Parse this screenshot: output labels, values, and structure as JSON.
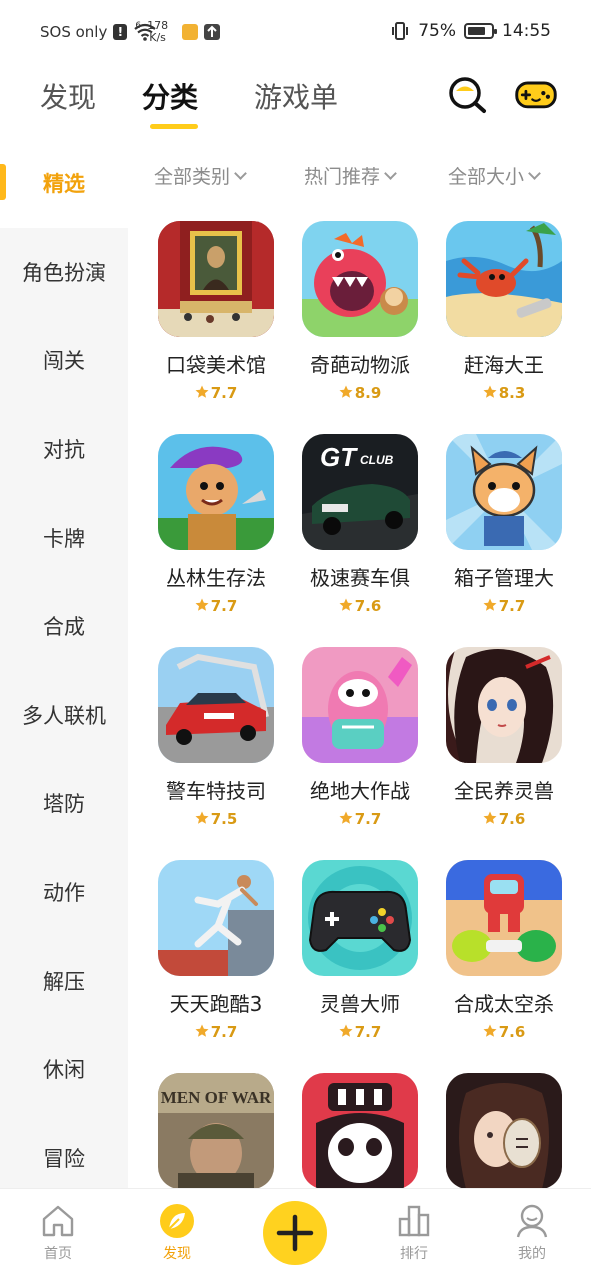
{
  "status_bar": {
    "carrier": "SOS only",
    "net_speed_value": "178",
    "net_speed_unit": "K/s",
    "signal_gen": "6",
    "battery_percent": "75%",
    "battery_level": 0.75,
    "time": "14:55"
  },
  "tabs": [
    {
      "label": "发现",
      "active": false
    },
    {
      "label": "分类",
      "active": true
    },
    {
      "label": "游戏单",
      "active": false
    }
  ],
  "top_icons": [
    "search-icon",
    "gamepad-icon"
  ],
  "sidebar": {
    "items": [
      {
        "label": "精选",
        "active": true
      },
      {
        "label": "角色扮演",
        "active": false
      },
      {
        "label": "闯关",
        "active": false
      },
      {
        "label": "对抗",
        "active": false
      },
      {
        "label": "卡牌",
        "active": false
      },
      {
        "label": "合成",
        "active": false
      },
      {
        "label": "多人联机",
        "active": false
      },
      {
        "label": "塔防",
        "active": false
      },
      {
        "label": "动作",
        "active": false
      },
      {
        "label": "解压",
        "active": false
      },
      {
        "label": "休闲",
        "active": false
      },
      {
        "label": "冒险",
        "active": false
      }
    ]
  },
  "filters": [
    {
      "label": "全部类别"
    },
    {
      "label": "热门推荐"
    },
    {
      "label": "全部大小"
    }
  ],
  "games": [
    {
      "name": "口袋美术馆",
      "rating": "7.7"
    },
    {
      "name": "奇葩动物派",
      "rating": "8.9"
    },
    {
      "name": "赶海大王",
      "rating": "8.3"
    },
    {
      "name": "丛林生存法",
      "rating": "7.7"
    },
    {
      "name": "极速赛车俱",
      "rating": "7.6"
    },
    {
      "name": "箱子管理大",
      "rating": "7.7"
    },
    {
      "name": "警车特技司",
      "rating": "7.5"
    },
    {
      "name": "绝地大作战",
      "rating": "7.7"
    },
    {
      "name": "全民养灵兽",
      "rating": "7.6"
    },
    {
      "name": "天天跑酷3",
      "rating": "7.7"
    },
    {
      "name": "灵兽大师",
      "rating": "7.7"
    },
    {
      "name": "合成太空杀",
      "rating": "7.6"
    },
    {
      "name": "",
      "rating": "",
      "icon_text": "MEN OF WAR"
    },
    {
      "name": "",
      "rating": ""
    },
    {
      "name": "",
      "rating": ""
    }
  ],
  "bottom_nav": [
    {
      "label": "首页",
      "active": false
    },
    {
      "label": "发现",
      "active": true
    },
    {
      "label": "",
      "active": false
    },
    {
      "label": "排行",
      "active": false
    },
    {
      "label": "我的",
      "active": false
    }
  ],
  "colors": {
    "accent": "#ffcc1a",
    "active_text": "#f2a20c",
    "rating": "#d99a14",
    "sidebar_bg": "#f6f6f6"
  }
}
